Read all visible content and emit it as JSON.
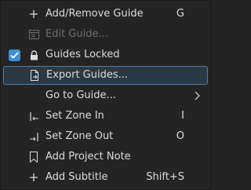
{
  "menu": {
    "items": [
      {
        "label": "Add/Remove Guide",
        "shortcut": "G",
        "icon": "plus-icon"
      },
      {
        "label": "Edit Guide...",
        "shortcut": "",
        "icon": "edit-guide-icon",
        "disabled": true
      },
      {
        "label": "Guides Locked",
        "shortcut": "",
        "icon": "lock-icon",
        "checked": true
      },
      {
        "label": "Export Guides...",
        "shortcut": "",
        "icon": "export-icon",
        "highlighted": true
      },
      {
        "label": "Go to Guide...",
        "shortcut": "",
        "icon": "",
        "submenu": true
      },
      {
        "label": "Set Zone In",
        "shortcut": "I",
        "icon": "zone-in-icon"
      },
      {
        "label": "Set Zone Out",
        "shortcut": "O",
        "icon": "zone-out-icon"
      },
      {
        "label": "Add Project Note",
        "shortcut": "",
        "icon": "project-note-icon"
      },
      {
        "label": "Add Subtitle",
        "shortcut": "Shift+S",
        "icon": "plus-icon"
      }
    ]
  },
  "colors": {
    "background": "#242424",
    "text": "#dcdcdc",
    "disabled_text": "#6e6e6e",
    "highlight_border": "#4f7ea6",
    "highlight_bg": "#2b3944",
    "checkbox": "#3e8fd8"
  }
}
